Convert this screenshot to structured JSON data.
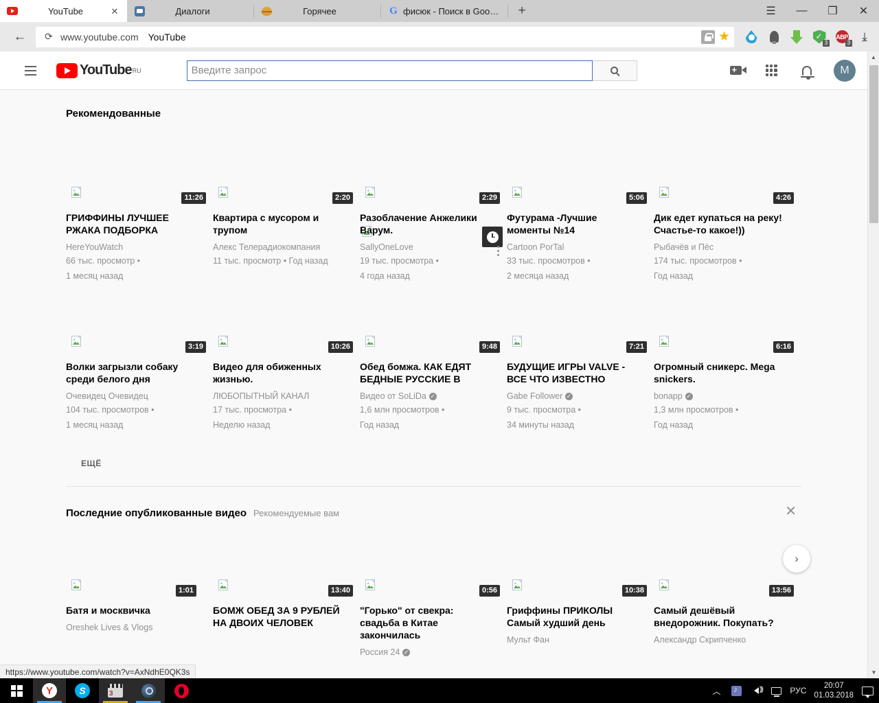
{
  "browser": {
    "tabs": [
      {
        "title": "YouTube",
        "favicon": "youtube-icon",
        "active": true,
        "close": "✕"
      },
      {
        "title": "Диалоги",
        "favicon": "vk-messages-icon",
        "active": false
      },
      {
        "title": "Горячее",
        "favicon": "pikabu-icon",
        "active": false
      },
      {
        "title": "фисюк - Поиск в Google",
        "favicon": "google-icon",
        "active": false
      }
    ],
    "new_tab_label": "+",
    "window_controls": {
      "menu": "☰",
      "minimize": "—",
      "restore": "❐",
      "close": "✕"
    },
    "nav": {
      "back": "←",
      "reload": "⟳",
      "url": "www.youtube.com",
      "page_title": "YouTube"
    },
    "extensions": [
      {
        "name": "lock-icon",
        "badge": ""
      },
      {
        "name": "bookmark-star-icon",
        "badge": ""
      },
      {
        "name": "waterdrop-icon",
        "badge": ""
      },
      {
        "name": "lightbulb-icon",
        "badge": ""
      },
      {
        "name": "download-helper-icon",
        "badge": ""
      },
      {
        "name": "shield-icon",
        "badge": "3"
      },
      {
        "name": "adblock-plus-icon",
        "badge": "3",
        "label": "ABP"
      },
      {
        "name": "downloads-icon",
        "badge": ""
      }
    ],
    "status_url": "https://www.youtube.com/watch?v=AxNdhE0QK3s"
  },
  "youtube": {
    "logo": {
      "text": "YouTube",
      "sup": "RU"
    },
    "search": {
      "placeholder": "Введите запрос",
      "value": ""
    },
    "header_icons": [
      "create-video-icon",
      "apps-grid-icon",
      "notifications-bell-icon"
    ],
    "avatar_letter": "M",
    "sections": [
      {
        "title": "Рекомендованные",
        "subtitle": "",
        "more_label": "ЕЩЁ",
        "rows": [
          [
            {
              "title": "ГРИФФИНЫ ЛУЧШЕЕ РЖАКА ПОДБОРКА",
              "channel": "HereYouWatch",
              "verified": false,
              "views": "66 тыс. просмотр •",
              "age": "1 месяц назад",
              "duration": "11:26"
            },
            {
              "title": "Квартира с мусором и трупом",
              "channel": "Алекс Телерадиокомпания",
              "verified": false,
              "views": "11 тыс. просмотр • Год назад",
              "age": "",
              "duration": "2:20"
            },
            {
              "title": "Разоблачение Анжелики Варум.",
              "channel": "SallyOneLove",
              "verified": false,
              "views": "19 тыс. просмотра •",
              "age": "4 года назад",
              "duration": "2:29"
            },
            {
              "title": "Футурама -Лучшие моменты №14",
              "channel": "Cartoon PorTal",
              "verified": false,
              "views": "33 тыс. просмотров •",
              "age": "2 месяца назад",
              "duration": "5:06"
            },
            {
              "title": "Дик едет купаться на реку! Счастье-то какое!))",
              "channel": "Рыбачёв и Пёс",
              "verified": false,
              "views": "174 тыс. просмотров •",
              "age": "Год назад",
              "duration": "4:26"
            }
          ],
          [
            {
              "title": "Волки загрызли собаку среди белого дня",
              "channel": "Очевидец Очевидец",
              "verified": false,
              "views": "104 тыс. просмотров •",
              "age": "1 месяц назад",
              "duration": "3:19"
            },
            {
              "title": "Видео для обиженных жизнью.",
              "channel": "ЛЮБОПЫТНЫЙ КАНАЛ",
              "verified": false,
              "views": "17 тыс. просмотра •",
              "age": "Неделю назад",
              "duration": "10:26"
            },
            {
              "title": "Обед бомжа. КАК ЕДЯТ БЕДНЫЕ РУССКИЕ В",
              "channel": "Видео от SoLiDa",
              "verified": true,
              "views": "1,6 млн просмотров •",
              "age": "Год назад",
              "duration": "9:48"
            },
            {
              "title": "БУДУЩИЕ ИГРЫ VALVE - ВСЕ ЧТО ИЗВЕСТНО",
              "channel": "Gabe Follower",
              "verified": true,
              "views": "9 тыс. просмотра •",
              "age": "34 минуты назад",
              "duration": "7:21"
            },
            {
              "title": "Огромный сникерс. Mega snickers.",
              "channel": "bonapp",
              "verified": true,
              "views": "1,3 млн просмотров •",
              "age": "Год назад",
              "duration": "6:16"
            }
          ]
        ]
      },
      {
        "title": "Последние опубликованные видео",
        "subtitle": "Рекомендуемые вам",
        "close_label": "✕",
        "next_label": "›",
        "rows": [
          [
            {
              "title": "Батя и москвичка",
              "channel": "Oreshek Lives & Vlogs",
              "verified": false,
              "views": "",
              "age": "",
              "duration": "1:01"
            },
            {
              "title": "БОМЖ ОБЕД ЗА 9 РУБЛЕЙ НА ДВОИХ ЧЕЛОВЕК",
              "channel": "",
              "verified": false,
              "views": "",
              "age": "",
              "duration": "13:40"
            },
            {
              "title": "\"Горько\" от свекра: свадьба в Китае закончилась",
              "channel": "Россия 24",
              "verified": true,
              "views": "",
              "age": "",
              "duration": "0:56"
            },
            {
              "title": "Гриффины ПРИКОЛЫ Самый худший день",
              "channel": "Мульт Фан",
              "verified": false,
              "views": "",
              "age": "",
              "duration": "10:38"
            },
            {
              "title": "Самый дешёвый внедорожник. Покупать?",
              "channel": "Александр Скрипченко",
              "verified": false,
              "views": "",
              "age": "",
              "duration": "13:56"
            }
          ]
        ]
      }
    ]
  },
  "taskbar": {
    "start": "windows-start-icon",
    "items": [
      "yandex-browser-icon",
      "skype-icon",
      "video-editor-icon",
      "steam-icon",
      "opera-icon"
    ],
    "tray": {
      "expand": "︿",
      "icons": [
        "music-note-icon",
        "volume-icon",
        "network-icon"
      ],
      "language": "РУС",
      "time": "20:07",
      "date": "01.03.2018",
      "action_center": "action-center-icon"
    }
  },
  "colors": {
    "youtube_red": "#ff0000",
    "accent_blue": "#3f6fb5",
    "text_primary": "#030303",
    "text_secondary": "#909090",
    "page_bg": "#f9f9f9"
  }
}
